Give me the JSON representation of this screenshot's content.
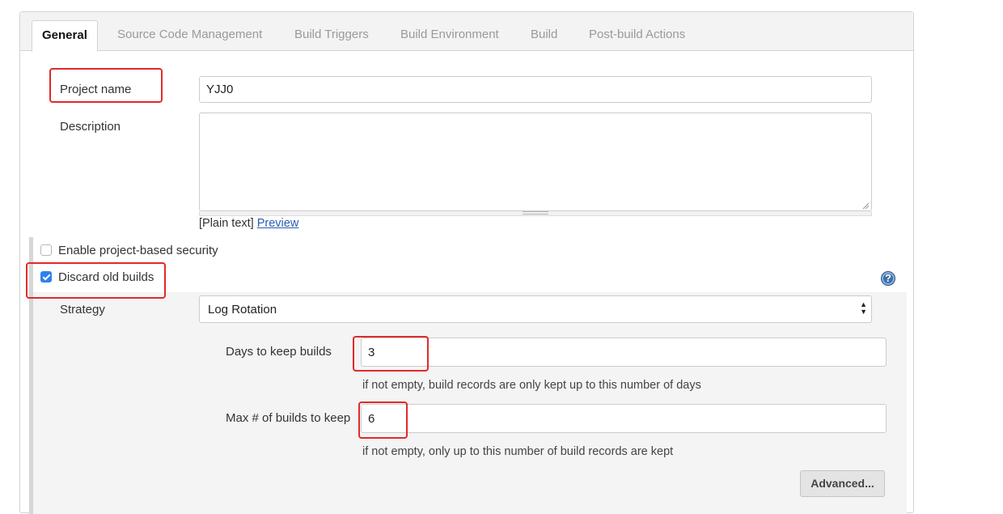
{
  "tabs": [
    {
      "label": "General",
      "active": true
    },
    {
      "label": "Source Code Management",
      "active": false
    },
    {
      "label": "Build Triggers",
      "active": false
    },
    {
      "label": "Build Environment",
      "active": false
    },
    {
      "label": "Build",
      "active": false
    },
    {
      "label": "Post-build Actions",
      "active": false
    }
  ],
  "project_name": {
    "label": "Project name",
    "value": "YJJ0"
  },
  "description": {
    "label": "Description",
    "value": "",
    "format_text": "[Plain text]",
    "preview_label": "Preview"
  },
  "security": {
    "label": "Enable project-based security",
    "checked": false
  },
  "discard_old_builds": {
    "label": "Discard old builds",
    "checked": true,
    "help_glyph": "?",
    "strategy": {
      "label": "Strategy",
      "value": "Log Rotation"
    },
    "days_to_keep": {
      "label": "Days to keep builds",
      "value": "3",
      "hint": "if not empty, build records are only kept up to this number of days"
    },
    "max_builds": {
      "label": "Max # of builds to keep",
      "value": "6",
      "hint": "if not empty, only up to this number of build records are kept"
    },
    "advanced_label": "Advanced..."
  },
  "icons": {
    "help": "help-icon",
    "select_arrows": "updown-arrows-icon",
    "check": "checkmark-icon"
  },
  "colors": {
    "highlight": "#e02a2a",
    "checkbox_checked": "#2f80ed",
    "link": "#2a5db0",
    "help_icon": "#3f6fa8"
  }
}
